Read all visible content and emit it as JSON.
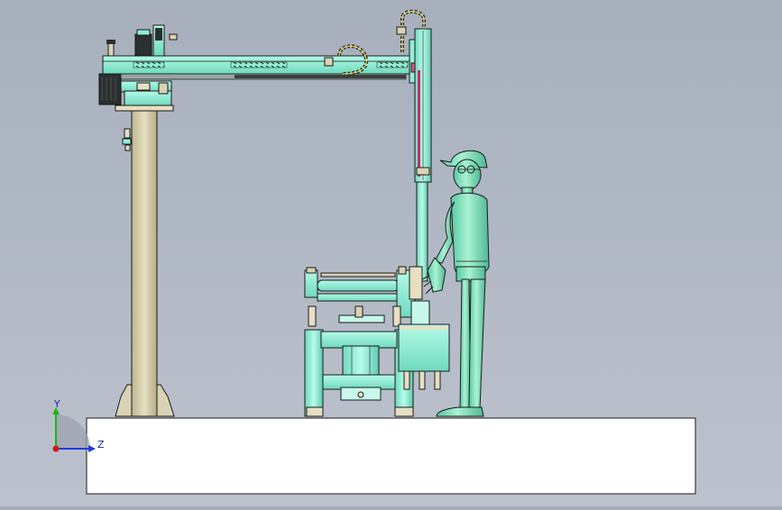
{
  "viewport": {
    "background": [
      "#a7afbd",
      "#bcc2cd"
    ],
    "model_color": "#8ff0d6",
    "model_dark": "#5fc9b0",
    "floor_color": "#ffffff",
    "column_color": "#d9d2b4",
    "line_color": "#1a1a1a"
  },
  "triad": {
    "y_label": "Y",
    "z_label": "Z",
    "y_color": "#1db31d",
    "z_color": "#1a3de0",
    "origin_color": "#d01818"
  }
}
